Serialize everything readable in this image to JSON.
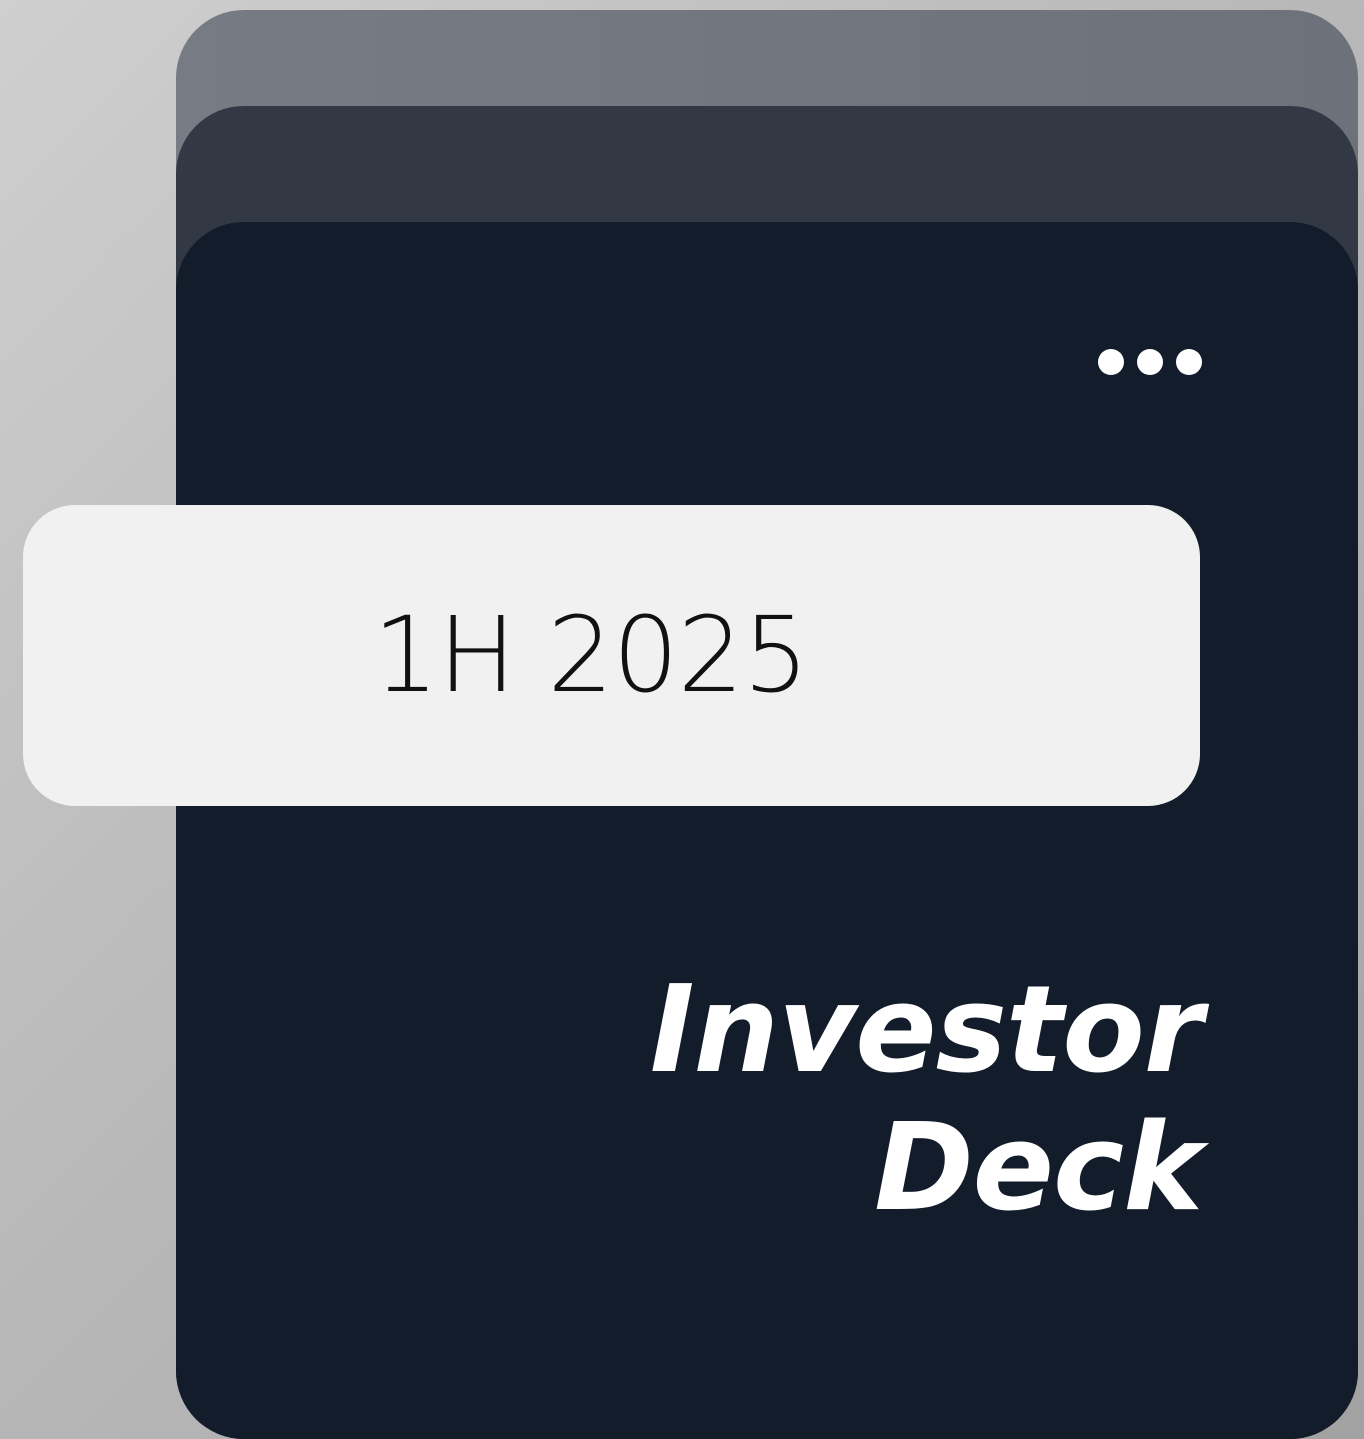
{
  "badge": {
    "period": "1H 2025"
  },
  "title": {
    "line1": "Investor",
    "line2": "Deck"
  },
  "menu": {
    "icon": "more-horizontal-icon"
  },
  "colors": {
    "card_front": "#131c2b",
    "card_middle": "#333944",
    "card_back": "#6f737c",
    "badge_background": "#f1f1f1",
    "text_light": "#ffffff",
    "text_dark": "#111111"
  }
}
